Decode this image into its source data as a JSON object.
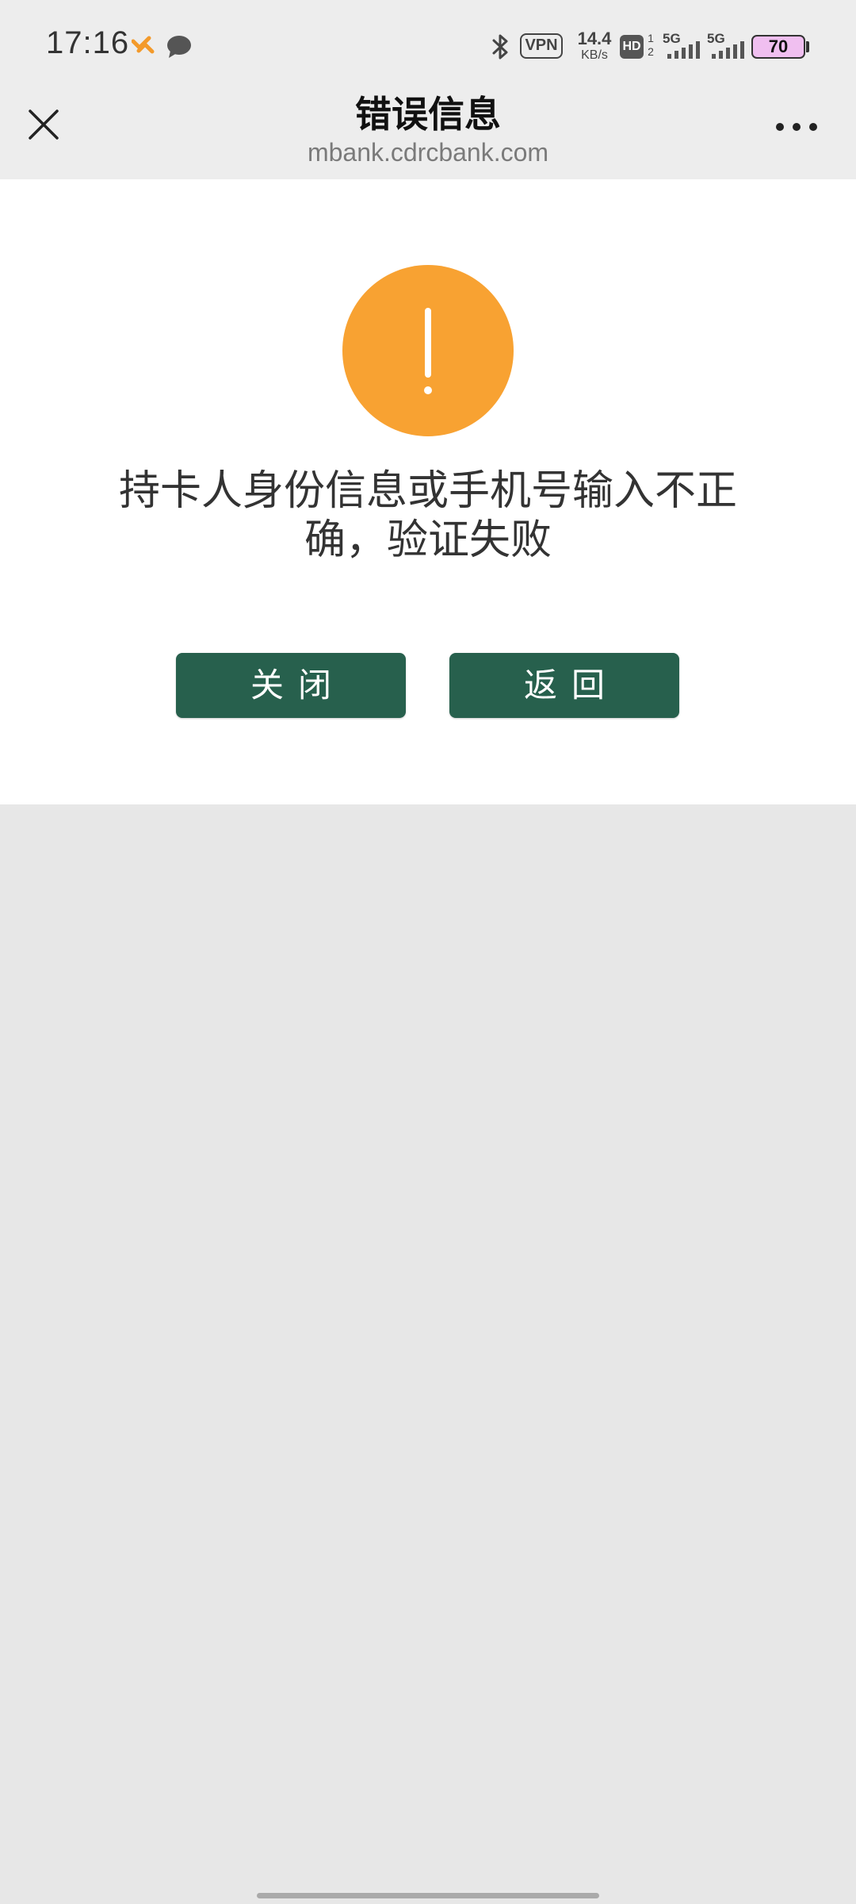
{
  "status_bar": {
    "time": "17:16",
    "vpn": "VPN",
    "net_speed_value": "14.4",
    "net_speed_unit": "KB/s",
    "hd_label": "HD",
    "hd_sub_top": "1",
    "hd_sub_bottom": "2",
    "signal_1_label": "5G",
    "signal_2_label": "5G",
    "battery": "70"
  },
  "header": {
    "title": "错误信息",
    "url": "mbank.cdrcbank.com"
  },
  "main": {
    "message": "持卡人身份信息或手机号输入不正确，验证失败",
    "close_button": "关闭",
    "back_button": "返回"
  },
  "colors": {
    "warning": "#f8a232",
    "button": "#27604d",
    "page_background": "#e7e7e7"
  }
}
